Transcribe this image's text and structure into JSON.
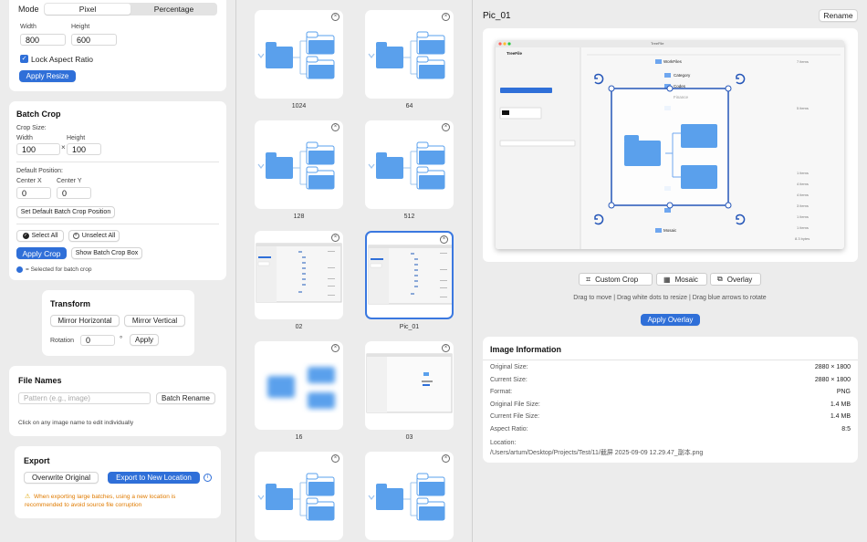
{
  "resize": {
    "mode_label": "Mode",
    "mode_options": [
      "Pixel",
      "Percentage"
    ],
    "width_label": "Width",
    "height_label": "Height",
    "width_value": "800",
    "height_value": "600",
    "lock_label": "Lock Aspect Ratio",
    "apply_label": "Apply Resize"
  },
  "batch_crop": {
    "title": "Batch Crop",
    "crop_size_label": "Crop Size:",
    "width_label": "Width",
    "height_label": "Height",
    "width_value": "100",
    "height_value": "100",
    "times": "×",
    "default_position_label": "Default Position:",
    "center_x_label": "Center X",
    "center_y_label": "Center Y",
    "center_x_value": "0",
    "center_y_value": "0",
    "set_default_label": "Set Default Batch Crop Position",
    "select_all_label": "Select All",
    "unselect_all_label": "Unselect All",
    "apply_crop_label": "Apply Crop",
    "show_box_label": "Show Batch Crop Box",
    "legend_label": "= Selected for batch crop"
  },
  "transform": {
    "title": "Transform",
    "mirror_h_label": "Mirror Horizontal",
    "mirror_v_label": "Mirror Vertical",
    "rotation_label": "Rotation",
    "rotation_value": "0",
    "degree": "°",
    "apply_label": "Apply"
  },
  "file_names": {
    "title": "File Names",
    "pattern_placeholder": "Pattern (e.g., image)",
    "batch_rename_label": "Batch Rename",
    "hint": "Click on any image name to edit individually"
  },
  "export": {
    "title": "Export",
    "overwrite_label": "Overwrite Original",
    "export_new_label": "Export to New Location",
    "warning": "When exporting large batches, using a new location is recommended to avoid source file corruption",
    "warning_color": "#e07b00"
  },
  "thumbnails": [
    {
      "name": "1024",
      "kind": "folder"
    },
    {
      "name": "64",
      "kind": "folder"
    },
    {
      "name": "128",
      "kind": "folder"
    },
    {
      "name": "512",
      "kind": "folder"
    },
    {
      "name": "02",
      "kind": "screenshot"
    },
    {
      "name": "Pic_01",
      "kind": "screenshot"
    },
    {
      "name": "16",
      "kind": "blur"
    },
    {
      "name": "03",
      "kind": "screenshot"
    },
    {
      "name": "",
      "kind": "folder"
    },
    {
      "name": "",
      "kind": "folder"
    }
  ],
  "preview": {
    "title": "Pic_01",
    "rename_label": "Rename",
    "custom_crop_label": "Custom Crop",
    "mosaic_label": "Mosaic",
    "overlay_label": "Overlay",
    "hint": "Drag to move | Drag white dots to resize | Drag blue arrows to rotate",
    "apply_overlay_label": "Apply Overlay",
    "accent": "#2f6fd8"
  },
  "shot": {
    "window_title": "TreeFile",
    "items": [
      "WorkFiles",
      "Category",
      "Codes",
      "Finance",
      "Docs",
      "Hello",
      "Mosaic"
    ],
    "counts": [
      "7 items",
      "5 items",
      "1 items",
      "4 items",
      "4 items",
      "3 items",
      "1 items",
      "1 items",
      "8.3 bytes"
    ]
  },
  "image_info": {
    "title": "Image Information",
    "rows": [
      {
        "label": "Original Size:",
        "value": "2880 × 1800"
      },
      {
        "label": "Current Size:",
        "value": "2880 × 1800"
      },
      {
        "label": "Format:",
        "value": "PNG"
      },
      {
        "label": "Original File Size:",
        "value": "1.4 MB"
      },
      {
        "label": "Current File Size:",
        "value": "1.4 MB"
      },
      {
        "label": "Aspect Ratio:",
        "value": "8:5"
      }
    ],
    "location_label": "Location:",
    "location_value": "/Users/artum/Desktop/Projects/Test/11/截屏 2025-09-09 12.29.47_副本.png"
  }
}
